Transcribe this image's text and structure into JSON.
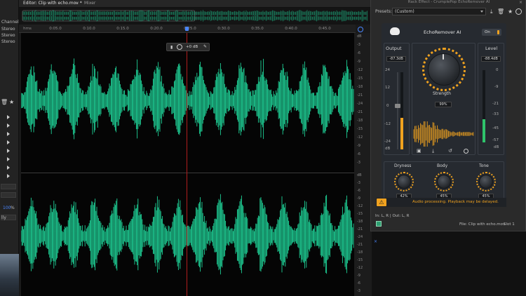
{
  "editor": {
    "tab_label": "Editor: Clip with echo.mov *",
    "mixer_label": "Mixer",
    "ruler_unit": "hms",
    "ruler_ticks": [
      "0:05.0",
      "0:10.0",
      "0:15.0",
      "0:20.0",
      "0:25.0",
      "0:30.0",
      "0:35.0",
      "0:40.0",
      "0:45.0"
    ],
    "hud_gain": "+0 dB",
    "db_scale_top": [
      "dB",
      "-3",
      "-6",
      "-9",
      "-12",
      "-15",
      "-18",
      "-21",
      "-24",
      "-21",
      "-18",
      "-15",
      "-12",
      "-9",
      "-6",
      "-3"
    ],
    "db_scale_bottom": [
      "dB",
      "-3",
      "-6",
      "-9",
      "-12",
      "-15",
      "-18",
      "-21",
      "-24",
      "-21",
      "-18",
      "-15",
      "-12",
      "-9",
      "-6",
      "-3"
    ],
    "waveform_color": "#1fd197",
    "playhead_color": "#b01d1d",
    "playhead_position_seconds": 25.0
  },
  "left_panel": {
    "channels_label": "Channels",
    "stereo_items": [
      "Stereo",
      "Stereo",
      "Stereo"
    ],
    "zoom_value": "100",
    "zoom_unit": "%",
    "fit_label": "lly"
  },
  "rack": {
    "title": "Rack Effect - CrumplePop EchoRemover AI",
    "presets_label": "Presets:",
    "preset_value": "(Custom)",
    "io_label": "In: L, R | Out: L, R",
    "file_label": "File: Clip with echo.mov",
    "slot_label": "Slot 1"
  },
  "plugin": {
    "name": "EchoRemover AI",
    "power_label": "On",
    "accent_color": "#f0a21f",
    "output": {
      "label": "Output",
      "readout": "-87.3dB",
      "scale": [
        "24",
        "12",
        "0",
        "-12",
        "-24",
        "dB"
      ],
      "fader_db": 0
    },
    "level": {
      "label": "Level",
      "readout": "-88.4dB",
      "scale": [
        "0",
        "-9",
        "-21",
        "-33",
        "-45",
        "-57",
        "dB"
      ],
      "meter_fill": 0.32
    },
    "strength": {
      "label": "Strength",
      "value": "99%"
    },
    "dryness": {
      "label": "Dryness",
      "value": "42%"
    },
    "body": {
      "label": "Body",
      "value": "45%"
    },
    "tone": {
      "label": "Tone",
      "value": "45%"
    },
    "warning": "Audio processing. Playback may be delayed."
  }
}
